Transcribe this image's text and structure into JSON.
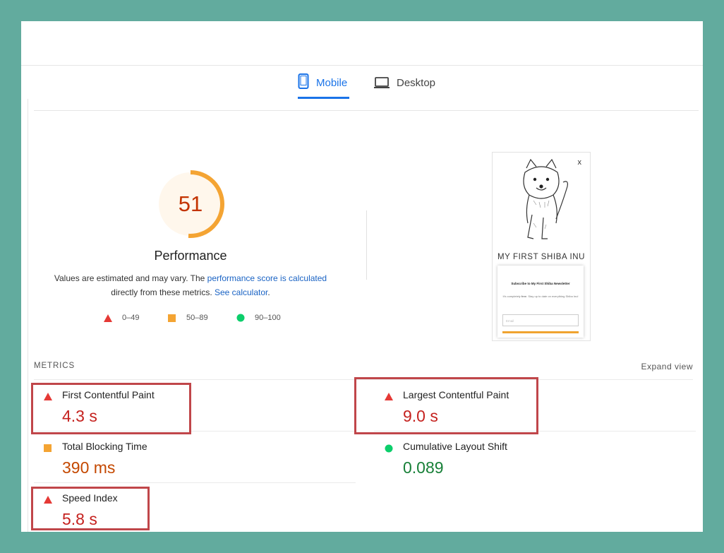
{
  "tabs": [
    {
      "label": "Mobile",
      "icon": "mobile-icon",
      "active": true
    },
    {
      "label": "Desktop",
      "icon": "desktop-icon",
      "active": false
    }
  ],
  "performance": {
    "score": "51",
    "score_value": 51,
    "title": "Performance",
    "desc_prefix": "Values are estimated and may vary. The ",
    "desc_link1": "performance score is calculated",
    "desc_middle": "directly from these metrics. ",
    "desc_link2": "See calculator",
    "desc_suffix": ".",
    "color": "#f4a433"
  },
  "legend": [
    {
      "range": "0–49",
      "icon": "triangle-icon",
      "color": "#e53935"
    },
    {
      "range": "50–89",
      "icon": "square-icon",
      "color": "#f4a433"
    },
    {
      "range": "90–100",
      "icon": "circle-icon",
      "color": "#0cce6b"
    }
  ],
  "screenshot": {
    "close": "x",
    "brand": "MY FIRST SHIBA INU",
    "card_title": "Subscribe to My First Shiba Newsletter",
    "card_text_a": "It's completely ",
    "card_text_bold": "free",
    "card_text_b": ". Stay up to date on everything Shiba Inu!",
    "card_placeholder": "Email"
  },
  "metrics_heading": "METRICS",
  "expand_view": "Expand view",
  "metrics": [
    {
      "label": "First Contentful Paint",
      "value": "4.3 s",
      "status": "poor",
      "icon": "triangle-icon"
    },
    {
      "label": "Largest Contentful Paint",
      "value": "9.0 s",
      "status": "poor",
      "icon": "triangle-icon"
    },
    {
      "label": "Total Blocking Time",
      "value": "390 ms",
      "status": "average",
      "icon": "square-icon"
    },
    {
      "label": "Cumulative Layout Shift",
      "value": "0.089",
      "status": "good",
      "icon": "circle-icon"
    },
    {
      "label": "Speed Index",
      "value": "5.8 s",
      "status": "poor",
      "icon": "triangle-icon"
    }
  ]
}
